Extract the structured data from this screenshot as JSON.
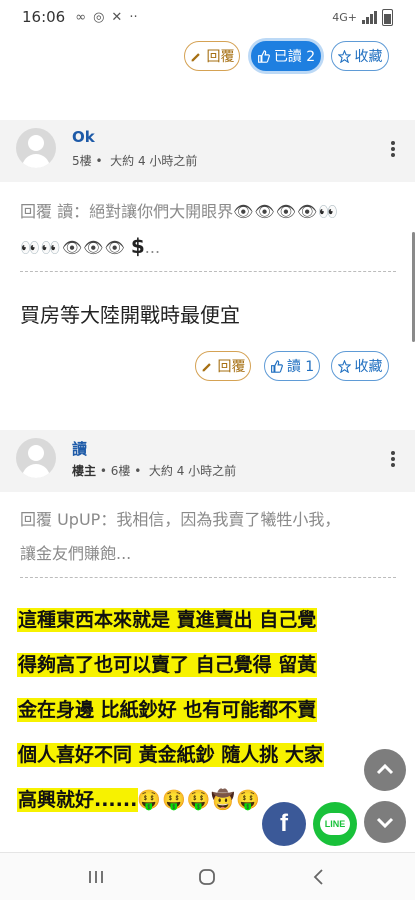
{
  "status_bar": {
    "time": "16:06",
    "icons": [
      "∞",
      "◎",
      "✕",
      "··"
    ],
    "network": "4G+"
  },
  "post_actions_top": {
    "reply_label": "回覆",
    "read_label": "已讀 2",
    "fav_label": "收藏"
  },
  "comments": [
    {
      "name": "Ok",
      "floor": "5樓",
      "time": "大約 4 小時之前",
      "quote_prefix": "回覆 讀：絕對讓你們大開眼界",
      "quote_emoji_1": "👁👁👁👁👀",
      "quote_emoji_2": "👀👀👁👁👁",
      "quote_dollar": "$",
      "quote_suffix": "...",
      "body": "買房等大陸開戰時最便宜",
      "reply_label": "回覆",
      "read_label": "讀 1",
      "fav_label": "收藏"
    },
    {
      "name": "讀",
      "role": "樓主",
      "floor": "6樓",
      "time": "大約 4 小時之前",
      "quote_line1": "回覆 UpUP：我相信，因為我賣了犧牲小我，",
      "quote_line2": "讓金友們賺飽...",
      "body_lines": [
        "這種東西本來就是 賣進賣出 自己覺",
        "得夠高了也可以賣了 自己覺得 留黃",
        "金在身邊 比紙鈔好 也有可能都不賣",
        "個人喜好不同 黃金紙鈔 隨人挑 大家",
        "高興就好......"
      ],
      "body_emoji": "🤑🤑🤑🤠🤑"
    }
  ],
  "floating": {
    "facebook": "f",
    "line": "LINE"
  },
  "colors": {
    "accent": "#1e7fe0",
    "highlight": "#f7f200",
    "link": "#1d5aa8"
  },
  "nav_icons": [
    "recent-apps-icon",
    "home-icon",
    "back-icon"
  ]
}
